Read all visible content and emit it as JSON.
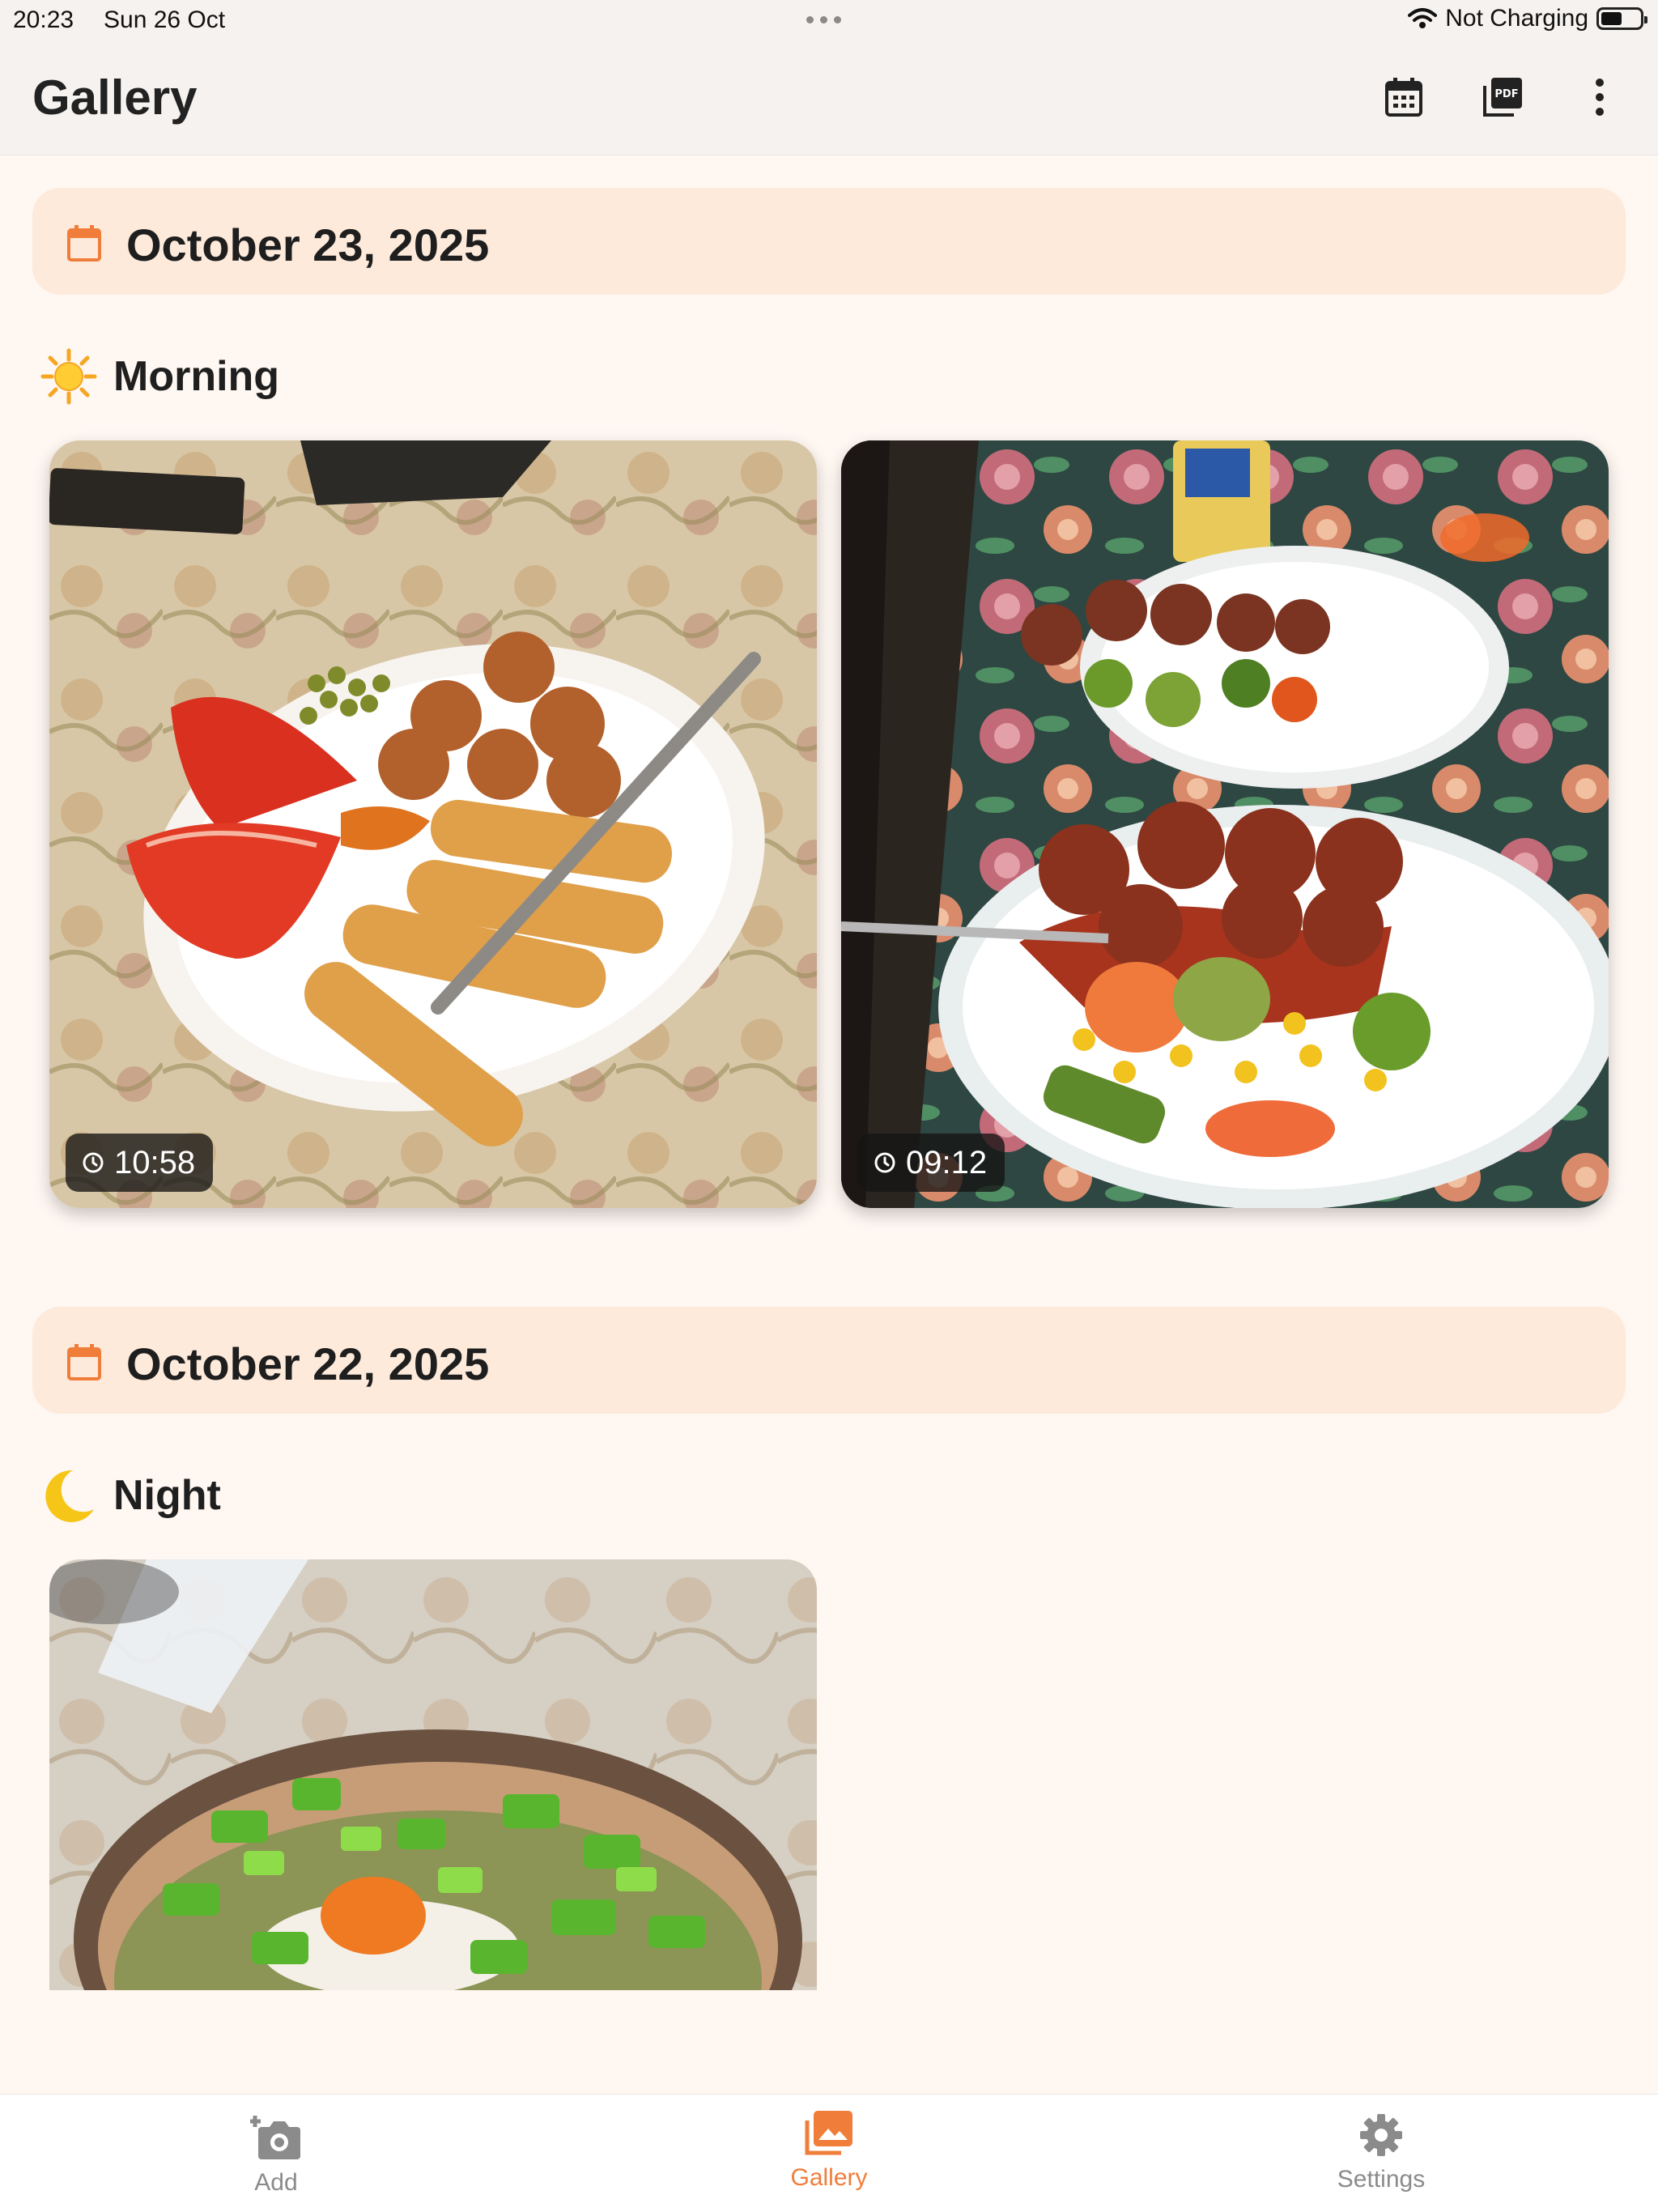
{
  "status_bar": {
    "time": "20:23",
    "date": "Sun 26 Oct",
    "charging": "Not Charging",
    "battery_level": 0.55
  },
  "header": {
    "title": "Gallery",
    "actions": [
      "calendar-icon",
      "pdf-icon",
      "more-vert-icon"
    ]
  },
  "sections": [
    {
      "date": "October 23, 2025",
      "meals": [
        {
          "label": "Morning",
          "icon": "sun-icon",
          "photos": [
            {
              "time": "10:58",
              "subject": "tomato-nuggets-fish-sticks"
            },
            {
              "time": "09:12",
              "subject": "meatballs-vegetables"
            }
          ]
        }
      ]
    },
    {
      "date": "October 22, 2025",
      "meals": [
        {
          "label": "Night",
          "icon": "moon-icon",
          "photos": [
            {
              "time": "",
              "subject": "egg-green-pepper-bowl"
            }
          ]
        }
      ]
    }
  ],
  "tabs": [
    {
      "label": "Add",
      "icon": "add-photo-icon",
      "active": false
    },
    {
      "label": "Gallery",
      "icon": "gallery-icon",
      "active": true
    },
    {
      "label": "Settings",
      "icon": "gear-icon",
      "active": false
    }
  ],
  "colors": {
    "accent": "#f07d3a",
    "banner_bg": "#fdeadb",
    "page_bg": "#fff7f2",
    "tab_inactive": "#8b8b8b"
  }
}
